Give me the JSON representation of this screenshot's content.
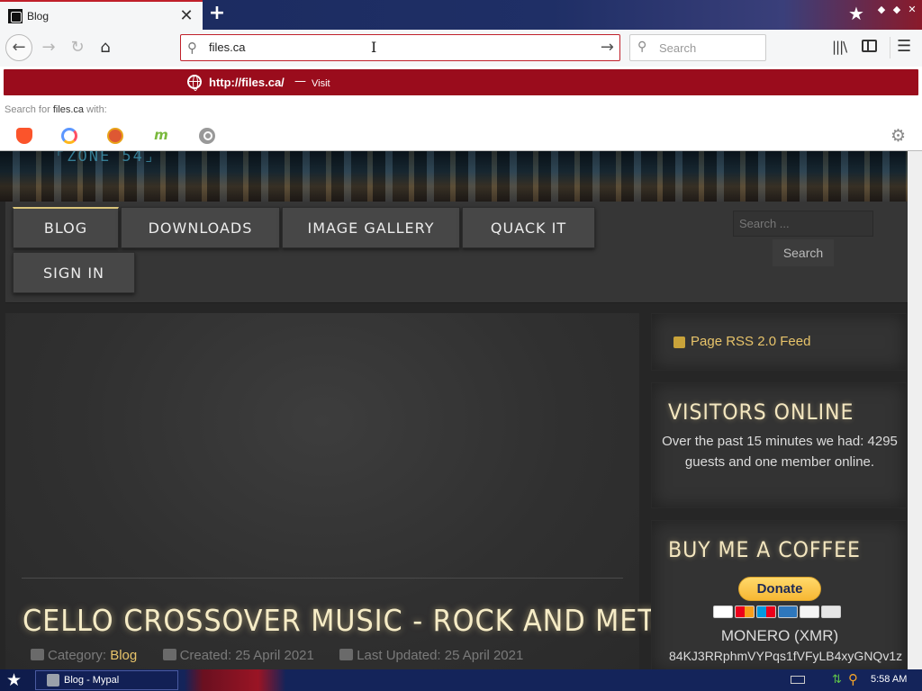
{
  "browser": {
    "tab": {
      "title": "Blog",
      "close_icon": "close-icon"
    },
    "nav": {
      "url": "files.ca",
      "search_placeholder": "Search"
    },
    "dropdown": {
      "suggestion_url": "http://files.ca/",
      "suggestion_sep": "—",
      "suggestion_action": "Visit",
      "search_with_prefix": "Search for ",
      "search_with_term": "files.ca",
      "search_with_suffix": " with:",
      "engines": [
        "brave-icon",
        "qwant-icon",
        "duckduckgo-icon",
        "mojeek-icon",
        "search-engine-icon"
      ],
      "mojeek_glyph": "m"
    }
  },
  "site": {
    "menu": {
      "blog": "BLOG",
      "downloads": "DOWNLOADS",
      "gallery": "IMAGE GALLERY",
      "quack": "QUACK IT",
      "signin": "SIGN IN"
    },
    "search": {
      "placeholder": "Search ...",
      "button": "Search"
    },
    "article": {
      "title": "CELLO CROSSOVER MUSIC - ROCK AND METAL",
      "category_label": "Category: ",
      "category": "Blog",
      "created": "Created: 25 April 2021",
      "updated": "Last Updated: 25 April 2021"
    },
    "sidebar": {
      "rss": "Page RSS 2.0 Feed",
      "visitors_title": "VISITORS ONLINE",
      "visitors_text": "Over the past 15 minutes we had: 4295 guests and one member online.",
      "coffee_title": "BUY ME A COFFEE",
      "donate": "Donate",
      "cards": [
        "visa",
        "mastercard",
        "maestro",
        "amex",
        "discover",
        "generic-card"
      ],
      "monero_label": "MONERO (XMR)",
      "monero_address": "84KJ3RRphmVYPqs1fVFyLB4xyGNQv1z"
    }
  },
  "taskbar": {
    "window_label": "Blog - Mypal",
    "clock": "5:58 AM"
  },
  "colors": {
    "accent": "#9a0c1c",
    "link_gold": "#e8c46a",
    "title_glow": "#f6ecc6"
  }
}
